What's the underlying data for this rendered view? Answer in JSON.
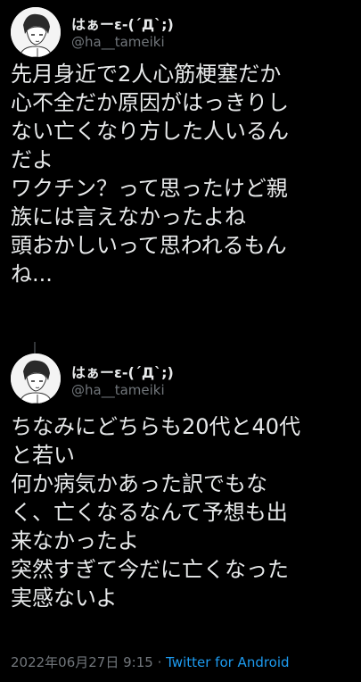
{
  "tweets": [
    {
      "display_name": "はぁーε-(´Д`;)",
      "handle": "@ha__tameiki",
      "lines": [
        "先月身近で2人心筋梗塞だか",
        "心不全だか原因がはっきりし",
        "ない亡くなり方した人いるん",
        "だよ",
        "ワクチン？って思ったけど親",
        "族には言えなかったよね",
        "頭おかしいって思われるもん",
        "ね..."
      ]
    },
    {
      "display_name": "はぁーε-(´Д`;)",
      "handle": "@ha__tameiki",
      "lines": [
        "ちなみにどちらも20代と40代",
        "と若い",
        "何か病気かあった訳でもな",
        "く、亡くなるなんて予想も出",
        "来なかったよ",
        "突然すぎて今だに亡くなった",
        "実感ないよ"
      ],
      "timestamp": "2022年06月27日 9:15",
      "separator": " · ",
      "source": "Twitter for Android"
    }
  ]
}
